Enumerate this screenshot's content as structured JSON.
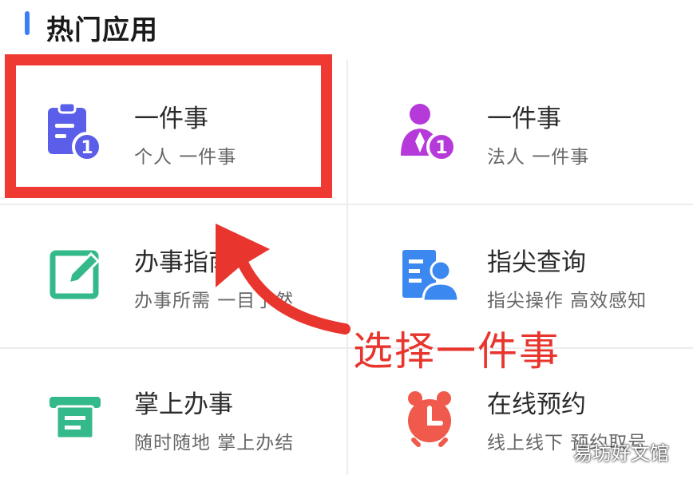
{
  "section": {
    "title": "热门应用"
  },
  "apps": [
    {
      "title": "一件事",
      "subtitle": "个人 一件事",
      "icon": "clipboard-badge-icon",
      "color": "#5b5ee8"
    },
    {
      "title": "一件事",
      "subtitle": "法人 一件事",
      "icon": "person-badge-icon",
      "color": "#b63ad9"
    },
    {
      "title": "办事指南",
      "subtitle": "办事所需 一目了然",
      "icon": "edit-icon",
      "color": "#33b98a"
    },
    {
      "title": "指尖查询",
      "subtitle": "指尖操作 高效感知",
      "icon": "document-person-icon",
      "color": "#3b88f0"
    },
    {
      "title": "掌上办事",
      "subtitle": "随时随地 掌上办结",
      "icon": "printer-icon",
      "color": "#33b98a"
    },
    {
      "title": "在线预约",
      "subtitle": "线上线下 预约取号",
      "icon": "alarm-clock-icon",
      "color": "#ef5a4c"
    }
  ],
  "badge_number": "1",
  "annotation": {
    "text": "选择一件事",
    "color": "#e8352e"
  },
  "watermark": "易坊好文馆"
}
